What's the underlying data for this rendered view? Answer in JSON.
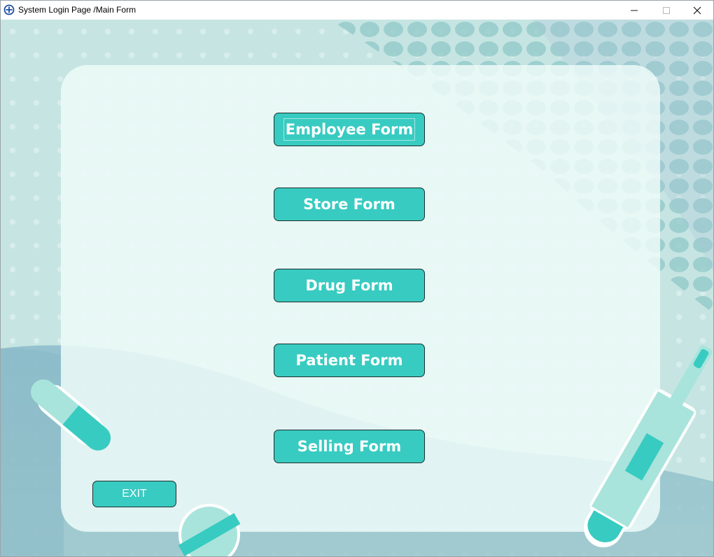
{
  "window": {
    "title": "System Login Page /Main Form",
    "icon": "circle-plus-icon",
    "controls": [
      "minimize-icon",
      "maximize-icon",
      "close-icon"
    ]
  },
  "buttons": {
    "employee": "Employee Form",
    "store": "Store Form",
    "drug": "Drug Form",
    "patient": "Patient Form",
    "selling": "Selling Form",
    "exit": "EXIT"
  },
  "colors": {
    "button": "#38cbc1",
    "panel": "#ecfaf8",
    "background": "#c6e5e2"
  }
}
